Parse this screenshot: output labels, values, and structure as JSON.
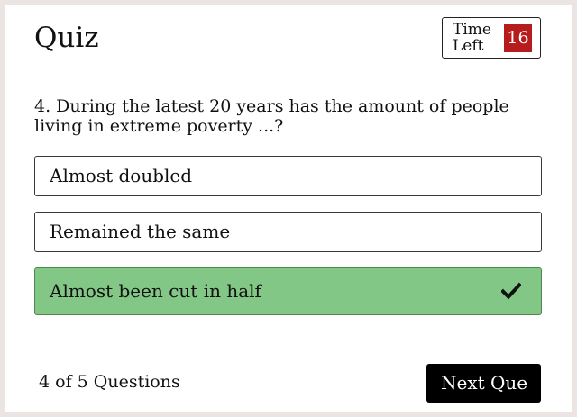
{
  "quiz": {
    "title": "Quiz"
  },
  "timer": {
    "label_line1": "Time",
    "label_line2": "Left",
    "value": "16",
    "value_color": "#b71c1c"
  },
  "question": {
    "text": "4. During the latest 20 years has the amount of people living in extreme poverty ...?"
  },
  "options": [
    {
      "label": "Almost doubled",
      "state": "default"
    },
    {
      "label": "Remained the same",
      "state": "default"
    },
    {
      "label": "Almost been cut in half",
      "state": "correct",
      "icon": "check-icon"
    }
  ],
  "colors": {
    "correct_background": "#82c785",
    "next_button_background": "#000000"
  },
  "footer": {
    "progress_text": "4 of 5 Questions",
    "next_label": "Next Que"
  }
}
